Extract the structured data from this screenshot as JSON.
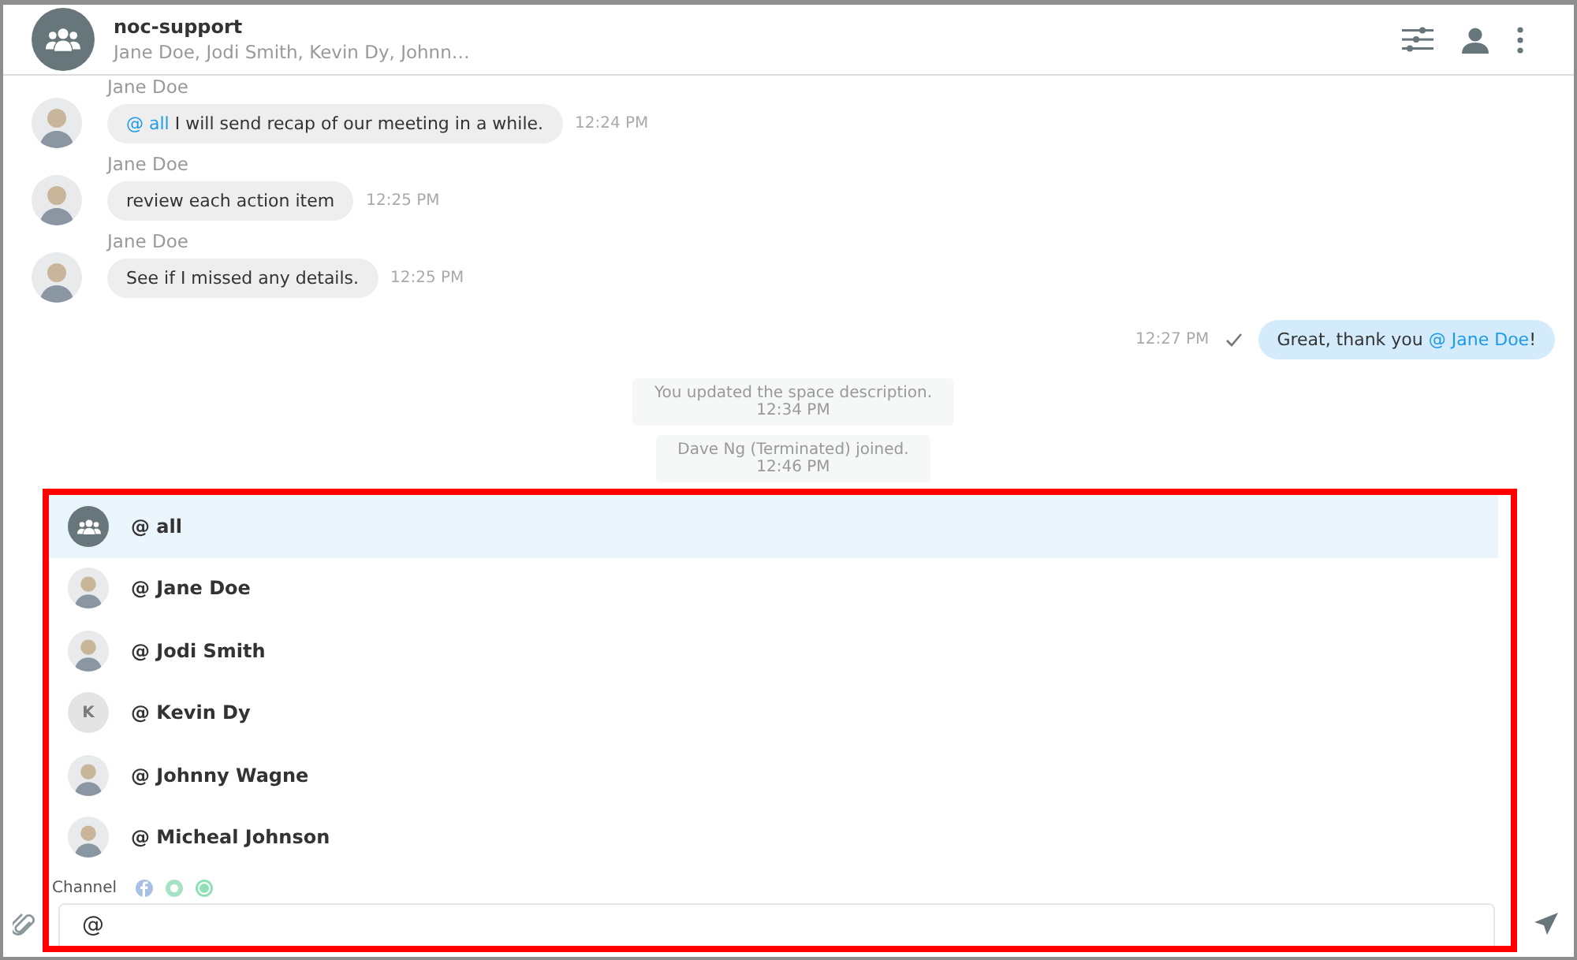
{
  "header": {
    "title": "noc-support",
    "members": "Jane Doe, Jodi Smith, Kevin Dy, Johnn…"
  },
  "messages": [
    {
      "kind": "incoming",
      "sender": "Jane Doe",
      "text": "@ all",
      "rest": " I will send recap of our meeting in a while.",
      "time": "12:24 PM"
    },
    {
      "kind": "incoming",
      "sender": "Jane Doe",
      "text": "review each action item",
      "time": "12:25 PM"
    },
    {
      "kind": "incoming",
      "sender": "Jane Doe",
      "text": "See if I missed any details.",
      "time": "12:25 PM"
    },
    {
      "kind": "outgoing",
      "text": "Great, thank you ",
      "mention": "@ Jane Doe",
      "rest": "!",
      "time": "12:27 PM",
      "sent": true
    },
    {
      "kind": "system",
      "text": "You updated the space description.",
      "time": "12:34 PM"
    },
    {
      "kind": "system",
      "text": "Dave Ng (Terminated) joined.",
      "time": "12:46 PM"
    }
  ],
  "mentions": [
    {
      "kind": "group",
      "label": "@ all",
      "selected": true
    },
    {
      "kind": "photo",
      "label": "@ Jane Doe",
      "selected": false
    },
    {
      "kind": "photo",
      "label": "@ Jodi Smith",
      "selected": false
    },
    {
      "kind": "initial",
      "initial": "K",
      "label": "@ Kevin Dy",
      "selected": false
    },
    {
      "kind": "photo",
      "label": "@ Johnny Wagne",
      "selected": false
    },
    {
      "kind": "photo",
      "label": "@ Micheal Johnson",
      "selected": false
    }
  ],
  "channel": {
    "label": "Channel"
  },
  "composer": {
    "value": "@"
  }
}
